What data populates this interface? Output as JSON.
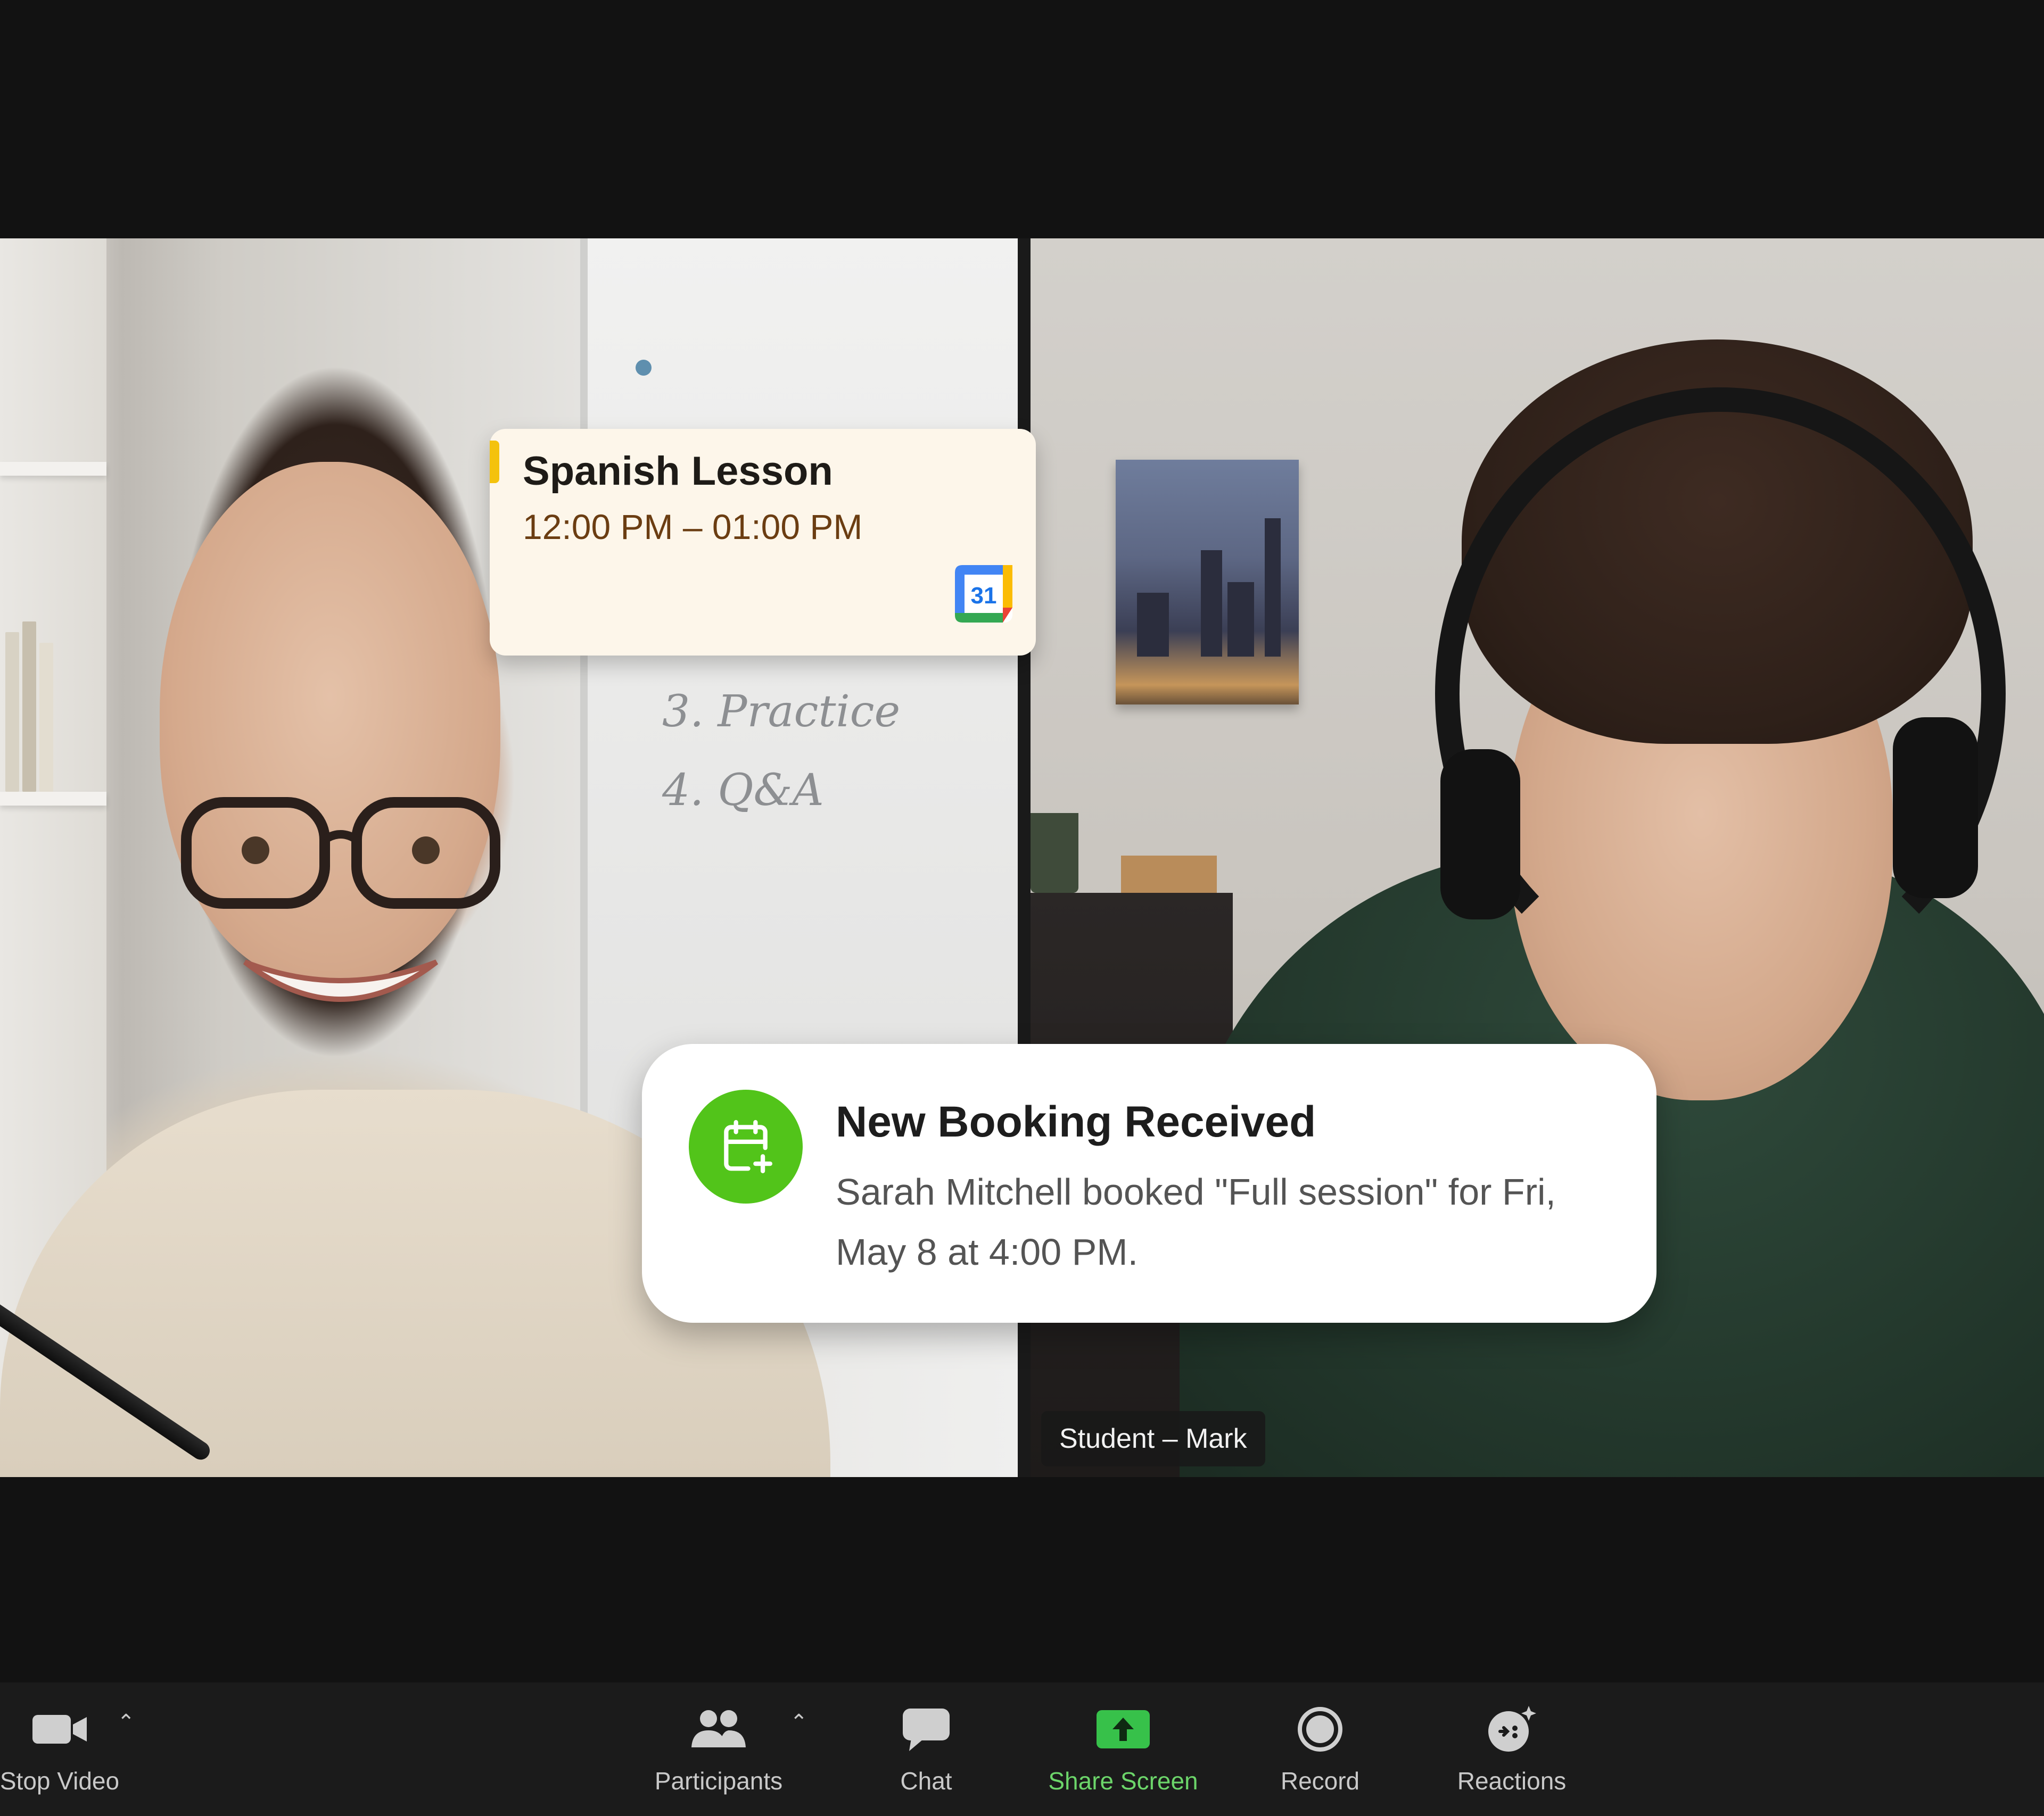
{
  "event_card": {
    "title": "Spanish Lesson",
    "time": "12:00 PM – 01:00 PM",
    "calendar_day": "31"
  },
  "whiteboard": {
    "lines": [
      "3. Practice",
      "4. Q&A"
    ]
  },
  "notification": {
    "title": "New Booking Received",
    "message": "Sarah Mitchell booked \"Full session\" for Fri, May 8 at 4:00 PM.",
    "icon": "calendar-plus-icon",
    "accent_color": "#52c41a"
  },
  "participants": {
    "student_label": "Student – Mark"
  },
  "toolbar": {
    "stop_video": "Stop Video",
    "participants": "Participants",
    "chat": "Chat",
    "share_screen": "Share Screen",
    "record": "Record",
    "reactions": "Reactions",
    "share_color": "#6cd56a"
  }
}
